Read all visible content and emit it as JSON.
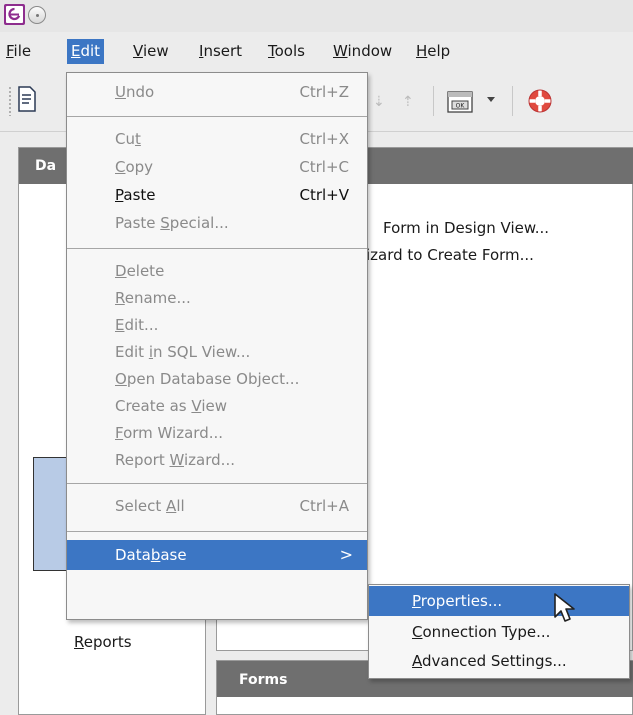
{
  "menubar": {
    "items": [
      {
        "label": "File",
        "u": "F",
        "rest": "ile"
      },
      {
        "label": "Edit",
        "u": "E",
        "rest": "dit"
      },
      {
        "label": "View",
        "u": "V",
        "rest": "iew"
      },
      {
        "label": "Insert",
        "u": "I",
        "rest": "nsert"
      },
      {
        "label": "Tools",
        "u": "T",
        "rest": "ools"
      },
      {
        "label": "Window",
        "u": "W",
        "rest": "indow"
      },
      {
        "label": "Help",
        "u": "H",
        "rest": "elp"
      }
    ]
  },
  "left_panel": {
    "header": "Da",
    "reports_u": "R",
    "reports_rest": "eports"
  },
  "tasks": {
    "items": [
      "Form in Design View...",
      "izard to Create Form..."
    ]
  },
  "forms_panel": {
    "header": "Forms"
  },
  "edit_menu": {
    "undo": {
      "pre": "",
      "u": "U",
      "post": "ndo",
      "shortcut": "Ctrl+Z"
    },
    "cut": {
      "pre": "Cu",
      "u": "t",
      "post": "",
      "shortcut": "Ctrl+X"
    },
    "copy": {
      "pre": "",
      "u": "C",
      "post": "opy",
      "shortcut": "Ctrl+C"
    },
    "paste": {
      "pre": "",
      "u": "P",
      "post": "aste",
      "shortcut": "Ctrl+V"
    },
    "paste_special": {
      "pre": "Paste ",
      "u": "S",
      "post": "pecial..."
    },
    "delete": {
      "pre": "",
      "u": "D",
      "post": "elete"
    },
    "rename": {
      "pre": "",
      "u": "R",
      "post": "ename..."
    },
    "edit": {
      "pre": "",
      "u": "E",
      "post": "dit..."
    },
    "edit_sql": {
      "pre": "Edit ",
      "u": "i",
      "post": "n SQL View..."
    },
    "open_db_object": {
      "pre": "",
      "u": "O",
      "post": "pen Database Object..."
    },
    "create_view": {
      "pre": "Create as ",
      "u": "V",
      "post": "iew"
    },
    "form_wizard": {
      "pre": "",
      "u": "F",
      "post": "orm Wizard..."
    },
    "report_wizard": {
      "pre": "Report ",
      "u": "W",
      "post": "izard..."
    },
    "select_all": {
      "pre": "Select ",
      "u": "A",
      "post": "ll",
      "shortcut": "Ctrl+A"
    },
    "database": {
      "pre": "Data",
      "u": "b",
      "post": "ase",
      "arrow": ">"
    }
  },
  "database_submenu": {
    "properties": {
      "pre": "",
      "u": "P",
      "post": "roperties..."
    },
    "connection_type": {
      "pre": "",
      "u": "C",
      "post": "onnection Type..."
    },
    "advanced_settings": {
      "pre": "",
      "u": "A",
      "post": "dvanced Settings..."
    }
  },
  "colors": {
    "highlight": "#3c76c4",
    "panel_header": "#6f6f6f",
    "selection": "#b8cbe6"
  }
}
